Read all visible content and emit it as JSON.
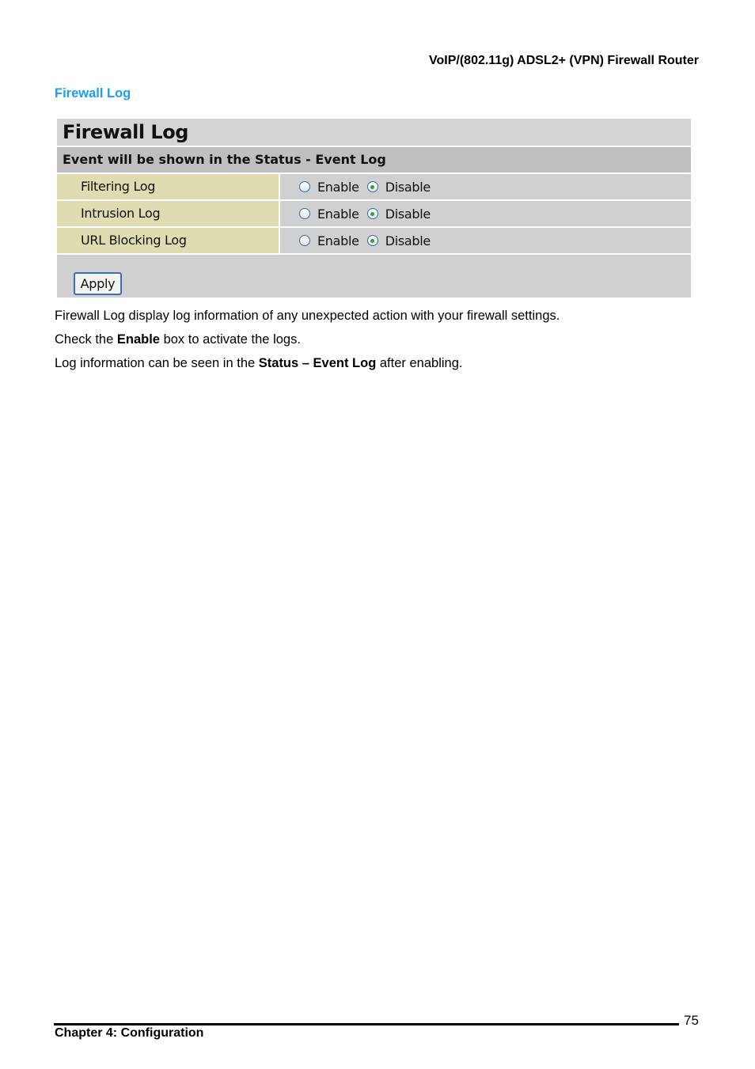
{
  "document": {
    "header_title": "VoIP/(802.11g) ADSL2+ (VPN) Firewall Router",
    "section_heading": "Firewall Log",
    "colors": {
      "section_heading": "#1a9ef0",
      "label_cell": "#dedcb0",
      "value_cell": "#d0d0d0",
      "radio_dot": "#2fa33a"
    }
  },
  "panel": {
    "title": "Firewall Log",
    "subtitle": "Event will be shown in the Status - Event Log",
    "rows": [
      {
        "label": "Filtering Log",
        "options": [
          "Enable",
          "Disable"
        ],
        "selected": "Disable"
      },
      {
        "label": "Intrusion Log",
        "options": [
          "Enable",
          "Disable"
        ],
        "selected": "Disable"
      },
      {
        "label": "URL Blocking Log",
        "options": [
          "Enable",
          "Disable"
        ],
        "selected": "Disable"
      }
    ],
    "apply_label": "Apply"
  },
  "body": {
    "p1": "Firewall Log display log information of any unexpected action with your firewall settings.",
    "p2_pre": "Check the ",
    "p2_bold": "Enable",
    "p2_post": " box to activate the logs.",
    "p3_pre": "Log information can be seen in the ",
    "p3_bold": "Status – Event Log",
    "p3_post": " after enabling."
  },
  "footer": {
    "chapter": "Chapter 4: Configuration",
    "page_number": "75"
  }
}
